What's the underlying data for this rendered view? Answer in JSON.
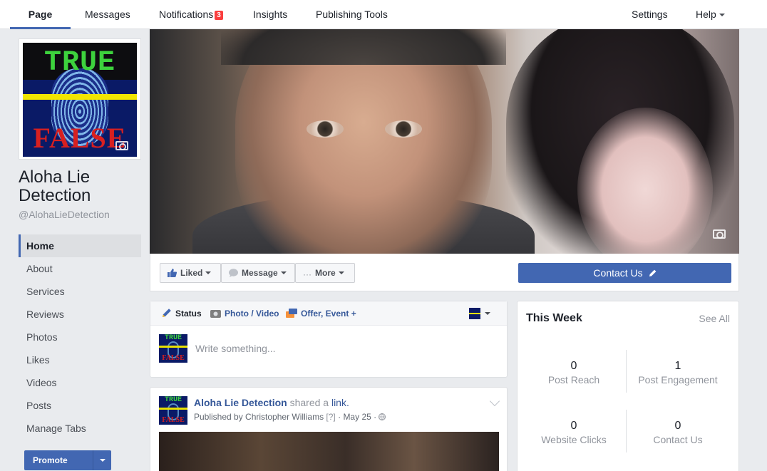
{
  "nav": {
    "tabs": [
      {
        "label": "Page"
      },
      {
        "label": "Messages"
      },
      {
        "label": "Notifications",
        "badge": "3"
      },
      {
        "label": "Insights"
      },
      {
        "label": "Publishing Tools"
      }
    ],
    "settings_label": "Settings",
    "help_label": "Help"
  },
  "profile": {
    "logo_top": "TRUE",
    "logo_bottom": "FALSE",
    "name": "Aloha Lie Detection",
    "handle": "@AlohaLieDetection"
  },
  "sidebar": {
    "items": [
      {
        "label": "Home"
      },
      {
        "label": "About"
      },
      {
        "label": "Services"
      },
      {
        "label": "Reviews"
      },
      {
        "label": "Photos"
      },
      {
        "label": "Likes"
      },
      {
        "label": "Videos"
      },
      {
        "label": "Posts"
      },
      {
        "label": "Manage Tabs"
      }
    ],
    "promote_label": "Promote"
  },
  "actions": {
    "liked_label": "Liked",
    "message_label": "Message",
    "more_label": "More",
    "contact_label": "Contact Us"
  },
  "composer": {
    "status_label": "Status",
    "photo_label": "Photo / Video",
    "offer_label": "Offer, Event +",
    "placeholder": "Write something..."
  },
  "post": {
    "author": "Aloha Lie Detection",
    "verb": "shared a",
    "object": "link.",
    "published_by": "Published by Christopher Williams",
    "help_mark": "[?]",
    "date": "May 25"
  },
  "this_week": {
    "title": "This Week",
    "see_all": "See All",
    "stats": [
      {
        "value": "0",
        "label": "Post Reach"
      },
      {
        "value": "1",
        "label": "Post Engagement"
      },
      {
        "value": "0",
        "label": "Website Clicks"
      },
      {
        "value": "0",
        "label": "Contact Us"
      }
    ]
  },
  "colors": {
    "brand_blue": "#4267b2",
    "link_blue": "#365899",
    "badge_red": "#fa3e3e",
    "page_bg": "#e9ebee"
  }
}
